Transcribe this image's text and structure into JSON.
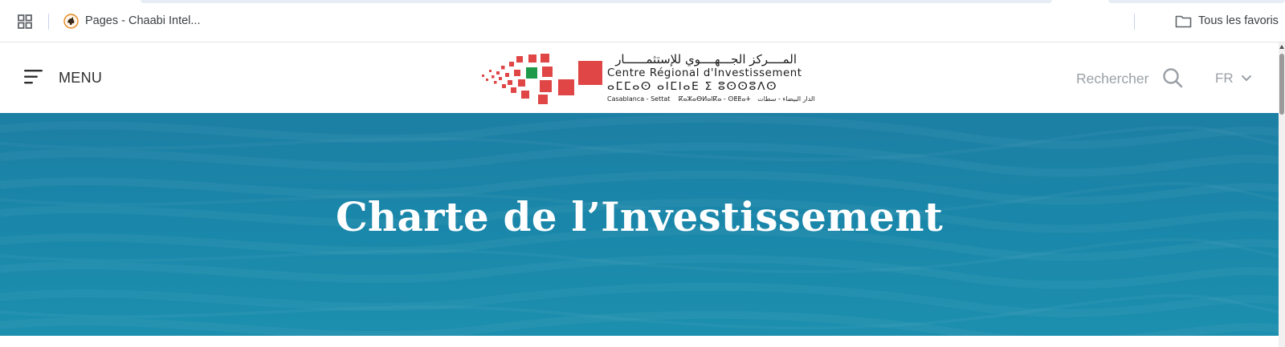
{
  "browser": {
    "bookmarks": [
      {
        "label": "Pages - Chaabi Intel..."
      }
    ],
    "all_bookmarks_label": "Tous les favoris"
  },
  "header": {
    "menu_label": "MENU",
    "search_label": "Rechercher",
    "language": "FR",
    "logo": {
      "arabic_name": "المــــركز الجـــهــــوي للإستثمــــــار",
      "french_name": "Centre Régional d'Investissement",
      "tifinagh_name": "ⴰⵎⵎⴰⵙ ⴰⵏⵎⵏⴰⴹ ⵉ ⵓⵙⵙⵓⴷⵙ",
      "region_fr": "Casablanca - Settat",
      "region_tifinagh": "ⴽⴰⵣⴰⴱⵍⴰⵏⴽⴰ - ⵙⵟⵟⴰⵜ",
      "region_ar": "الدار البيضاء - سطات"
    }
  },
  "hero": {
    "title": "Charte de l’Investissement"
  },
  "colors": {
    "brand_red": "#e04646",
    "brand_green": "#1f9a4a",
    "hero_blue": "#1a86a9"
  },
  "icons": {
    "apps": "grid-icon",
    "favicon": "chaabi-favicon-icon",
    "folder": "folder-icon",
    "menu": "hamburger-icon",
    "search": "search-icon",
    "language_toggle": "chevron-down-icon"
  }
}
